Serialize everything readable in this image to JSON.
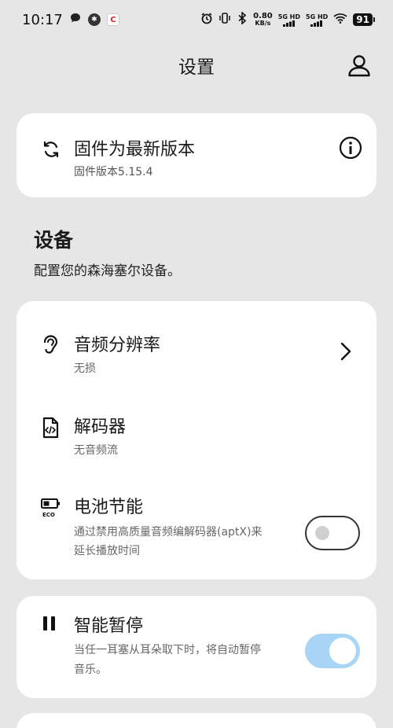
{
  "status_bar": {
    "time": "10:17",
    "speed_value": "0.80",
    "speed_unit": "KB/s",
    "net1": "5G HD",
    "net2": "5G HD",
    "battery": "91"
  },
  "header": {
    "title": "设置"
  },
  "firmware": {
    "title": "固件为最新版本",
    "version": "固件版本5.15.4"
  },
  "device_section": {
    "title": "设备",
    "description": "配置您的森海塞尔设备。"
  },
  "settings": {
    "resolution": {
      "title": "音频分辨率",
      "value": "无损"
    },
    "codec": {
      "title": "解码器",
      "value": "无音频流"
    },
    "battery_saving": {
      "title": "电池节能",
      "desc_line1": "通过禁用高质量音频编解码器(aptX)来",
      "desc_line2": "延长播放时间",
      "enabled": false
    },
    "smart_pause": {
      "title": "智能暂停",
      "desc_line1": "当任一耳塞从耳朵取下时，将自动暂停",
      "desc_line2": "音乐。",
      "enabled": true
    }
  },
  "colors": {
    "background": "#e6e6e6",
    "card": "#ffffff",
    "toggle_on": "#a8d4f6"
  }
}
